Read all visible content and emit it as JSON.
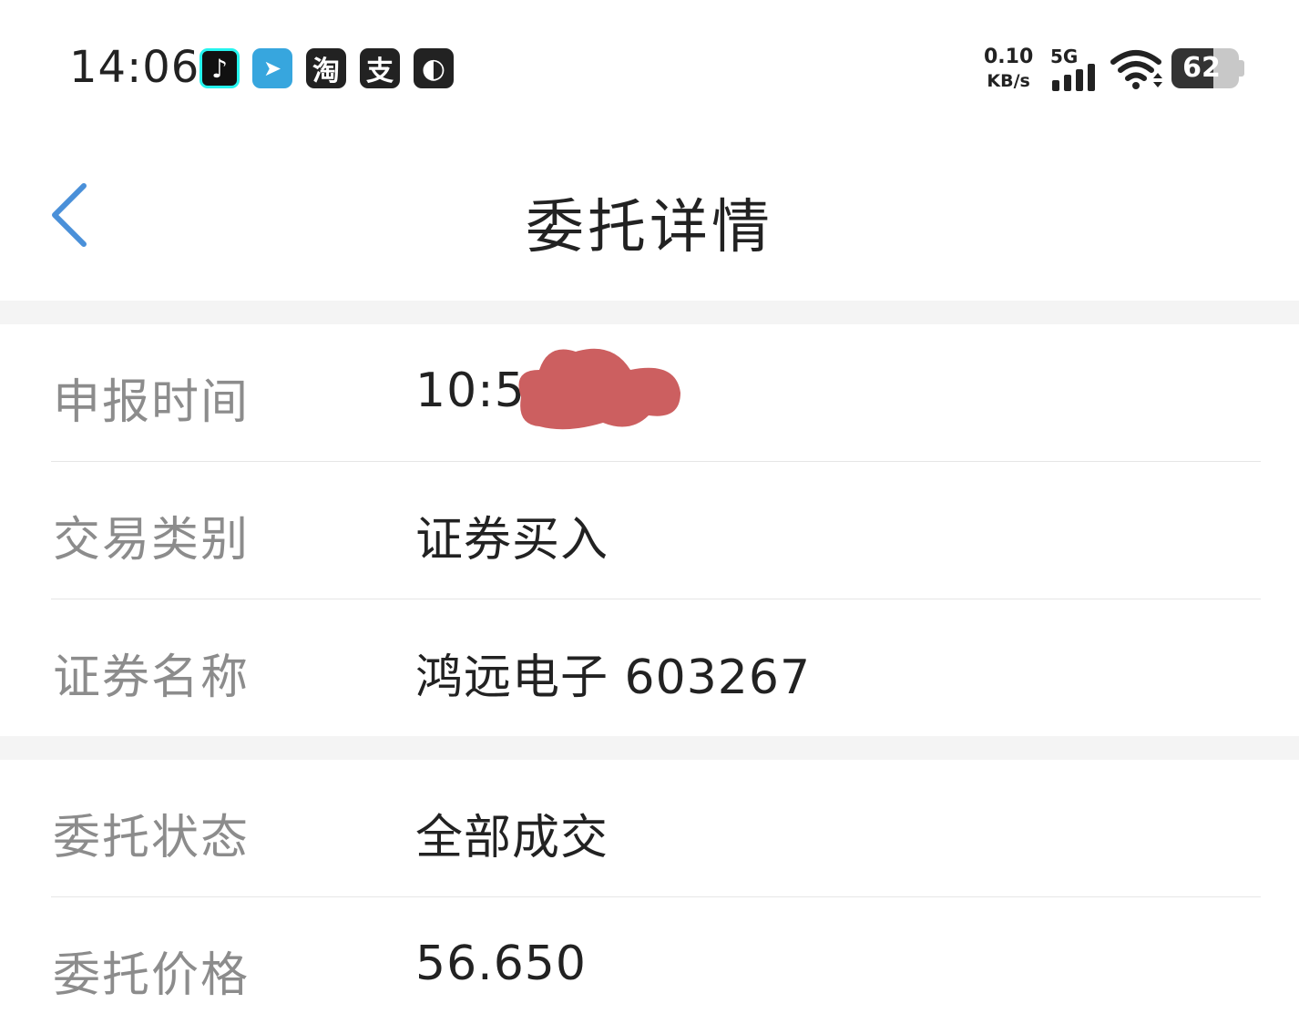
{
  "status_bar": {
    "time": "14:06",
    "apps": [
      {
        "icon": "tiktok-icon",
        "glyph": "♪",
        "color": "#111111"
      },
      {
        "icon": "telegram-icon",
        "glyph": "➤",
        "color": "#37a6de"
      },
      {
        "icon": "taobao-icon",
        "glyph": "淘",
        "color": "#222222"
      },
      {
        "icon": "alipay-icon",
        "glyph": "支",
        "color": "#222222"
      },
      {
        "icon": "browser-icon",
        "glyph": "◐",
        "color": "#222222"
      }
    ],
    "net_speed_value": "0.10",
    "net_speed_unit": "KB/s",
    "network_type": "5G",
    "battery_level": "62",
    "battery_fraction": 0.62
  },
  "header": {
    "title": "委托详情"
  },
  "details": {
    "group1": [
      {
        "label": "申报时间",
        "value": "10:58"
      },
      {
        "label": "交易类别",
        "value": "证券买入"
      },
      {
        "label": "证券名称",
        "value": "鸿远电子 603267"
      }
    ],
    "group2": [
      {
        "label": "委托状态",
        "value": "全部成交"
      },
      {
        "label": "委托价格",
        "value": "56.650"
      }
    ]
  },
  "colors": {
    "accent": "#4a90d9",
    "redaction": "#cc5f60",
    "label": "#8c8c8c",
    "separator": "#f4f4f4"
  }
}
